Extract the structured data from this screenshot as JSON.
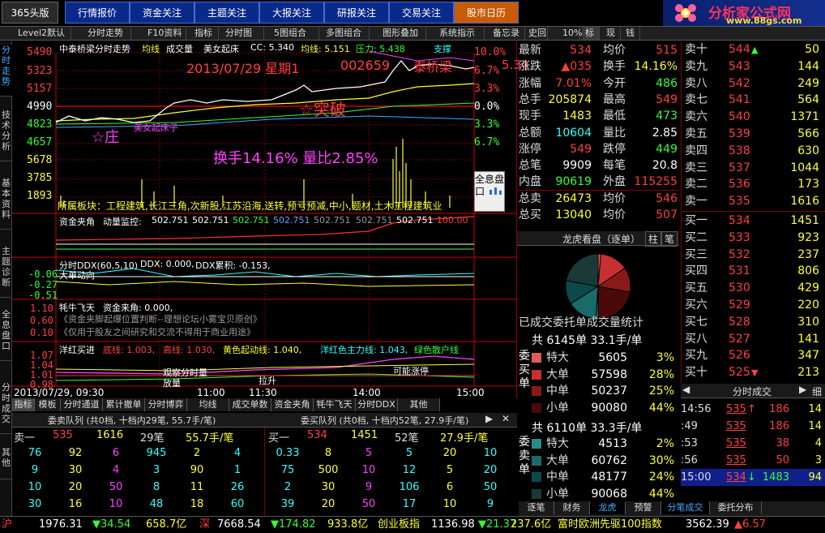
{
  "top_tabs": [
    "365头版",
    "行情报价",
    "资金关注",
    "主题关注",
    "大报关注",
    "研报关注",
    "交易关注",
    "股市日历"
  ],
  "logo": {
    "title": "分析家公式网",
    "url": "www.88gs.com"
  },
  "toolbar": [
    "Level2默认",
    "分时走势",
    "F10资料",
    "指标",
    "分时图",
    "5图组合",
    "多图组合",
    "图形叠加",
    "系统指示",
    "备忘录",
    "史回",
    "10%",
    "标",
    "现",
    "钱"
  ],
  "left_tabs": [
    "分时走势",
    "技术分析",
    "基本资料",
    "主题诊断",
    "全息盘口",
    "分时成交",
    "其他"
  ],
  "chart": {
    "header": "中泰桥梁分时走势",
    "header_avg": "均线",
    "header_vol": "成交量",
    "header_ind": "美女起床",
    "header_cc": "CC: 5.340",
    "header_jx": "均线: 5.151",
    "header_yl": "压力: 5.438",
    "header_zc": "支撑",
    "date_text": "2013/07/29 星期1",
    "code": "002659",
    "name_overlay": "泰桥梁",
    "right_price": "5.34",
    "tupo": "☆突破",
    "zhuang": "☆庄",
    "qichuang": "美女起床子",
    "turnover_text": "换手14.16% 量比2.85%",
    "prices": [
      "5490",
      "5323",
      "5157",
      "4990",
      "4823",
      "4657",
      "5678",
      "3785",
      "1893"
    ],
    "pcts": [
      "10.0%",
      "6.7%",
      "3.3%",
      "0.0%",
      "3.3%",
      "6.7%"
    ],
    "sector": "所属板块：工程建筑,长江三角,次新股,江苏沿海,送转,预亏预减,中小,题材,土木工程建筑业",
    "info_box": "全息盘口",
    "panel2_title": "资金夹角",
    "panel2_label": "动量监控:",
    "panel2_values": [
      "502.751",
      "502.751",
      "502.751",
      "502.751",
      "502.751",
      "502.751",
      "502.751",
      "100.00"
    ],
    "panel3_title": "分时DDX(60,5,10)",
    "panel3_ddx": "DDX: 0.000,",
    "panel3_ddxlj": "DDX累积: -0.153,",
    "panel3_sub": "大单动向",
    "panel3_axis": [
      "-0.06",
      "-0.27",
      "-0.51"
    ],
    "panel4_title": "牦牛飞天",
    "panel4_val": "资金来角: 0.000,",
    "panel4_line1": "《资金夹脚起爆位置判断--理想论坛小雾宝贝原创》",
    "panel4_line2": "《仅用于股友之间研究和交流不得用于商业用途》",
    "panel4_axis": [
      "1.10",
      "0.60",
      "0.10"
    ],
    "panel5_title": "洋红买进",
    "panel5_base": "底线: 1.003,",
    "panel5_high": "高线: 1.030,",
    "panel5_yellow": "黄色起动线: 1.040,",
    "panel5_ym": "洋红色主力线: 1.043,",
    "panel5_green": "绿色散户线",
    "panel5_axis": [
      "1.07",
      "1.04",
      "1.01",
      "0.98"
    ],
    "panel5_labels": [
      "观察分时量",
      "放量",
      "拉升",
      "可能涨停"
    ],
    "time_axis": [
      "2013/07/29, 09:30",
      "11:00",
      "11:30",
      "14:00",
      "15:00"
    ],
    "bottom_tabs": [
      "指标",
      "模板",
      "分时通道",
      "累计撤单",
      "分时博弈",
      "均线",
      "成交单数",
      "资金夹角",
      "牦牛飞天",
      "分时DDX",
      "其他"
    ]
  },
  "quotes": {
    "rows": [
      {
        "l": "最新",
        "v": "534",
        "l2": "均价",
        "v2": "515"
      },
      {
        "l": "涨跌",
        "v": "▲035",
        "l2": "换手",
        "v2": "14.16%"
      },
      {
        "l": "涨幅",
        "v": "7.01%",
        "l2": "今开",
        "v2": "486"
      },
      {
        "l": "总手",
        "v": "205874",
        "l2": "最高",
        "v2": "549"
      },
      {
        "l": "现手",
        "v": "1483",
        "l2": "最低",
        "v2": "473"
      },
      {
        "l": "总额",
        "v": "10604",
        "l2": "量比",
        "v2": "2.85"
      },
      {
        "l": "涨停",
        "v": "549",
        "l2": "跌停",
        "v2": "449"
      },
      {
        "l": "总笔",
        "v": "9909",
        "l2": "每笔",
        "v2": "20.8"
      },
      {
        "l": "内盘",
        "v": "90619",
        "l2": "外盘",
        "v2": "115255"
      },
      {
        "l": "总卖",
        "v": "26473",
        "l2": "均价",
        "v2": "546"
      },
      {
        "l": "总买",
        "v": "13040",
        "l2": "均价",
        "v2": "507"
      }
    ]
  },
  "book": {
    "asks": [
      {
        "l": "卖十",
        "p": "544",
        "a": "▲",
        "v": "50"
      },
      {
        "l": "卖九",
        "p": "543",
        "a": "",
        "v": "144"
      },
      {
        "l": "卖八",
        "p": "542",
        "a": "",
        "v": "249"
      },
      {
        "l": "卖七",
        "p": "541",
        "a": "",
        "v": "564"
      },
      {
        "l": "卖六",
        "p": "540",
        "a": "",
        "v": "1371"
      },
      {
        "l": "卖五",
        "p": "539",
        "a": "",
        "v": "566"
      },
      {
        "l": "卖四",
        "p": "538",
        "a": "",
        "v": "630"
      },
      {
        "l": "卖三",
        "p": "537",
        "a": "",
        "v": "1044"
      },
      {
        "l": "卖二",
        "p": "536",
        "a": "",
        "v": "173"
      },
      {
        "l": "卖一",
        "p": "535",
        "a": "",
        "v": "1616"
      }
    ],
    "bids": [
      {
        "l": "买一",
        "p": "534",
        "a": "",
        "v": "1451"
      },
      {
        "l": "买二",
        "p": "533",
        "a": "",
        "v": "923"
      },
      {
        "l": "买三",
        "p": "532",
        "a": "",
        "v": "237"
      },
      {
        "l": "买四",
        "p": "531",
        "a": "",
        "v": "806"
      },
      {
        "l": "买五",
        "p": "530",
        "a": "",
        "v": "429"
      },
      {
        "l": "买六",
        "p": "529",
        "a": "",
        "v": "220"
      },
      {
        "l": "买七",
        "p": "528",
        "a": "",
        "v": "310"
      },
      {
        "l": "买八",
        "p": "527",
        "a": "",
        "v": "141"
      },
      {
        "l": "买九",
        "p": "526",
        "a": "",
        "v": "347"
      },
      {
        "l": "买十",
        "p": "525",
        "a": "▼",
        "v": "213"
      }
    ]
  },
  "lhk": {
    "title": "龙虎看盘（逐单）",
    "btn1": "柱",
    "btn2": "笔",
    "pie_caption": "已成交委托单成交量统计",
    "buy_head": "共 6145单 33.1手/单",
    "buy_side": "委买单",
    "buy": [
      {
        "l": "特大",
        "v": "5605",
        "p": "3%"
      },
      {
        "l": "大单",
        "v": "57598",
        "p": "28%"
      },
      {
        "l": "中单",
        "v": "50237",
        "p": "25%"
      },
      {
        "l": "小单",
        "v": "90080",
        "p": "44%"
      }
    ],
    "sell_head": "共 6110单 33.3手/单",
    "sell_side": "委卖单",
    "sell": [
      {
        "l": "特大",
        "v": "4513",
        "p": "2%"
      },
      {
        "l": "大单",
        "v": "60762",
        "p": "30%"
      },
      {
        "l": "中单",
        "v": "48177",
        "p": "24%"
      },
      {
        "l": "小单",
        "v": "90068",
        "p": "44%"
      }
    ],
    "colors": [
      "#e05a5a",
      "#c83030",
      "#8a1a1a",
      "#4a0a0a",
      "#2a8a8a",
      "#1a6a6a",
      "#0a4a4a",
      "#1a3a3a"
    ]
  },
  "ticks": {
    "title": "分时成交",
    "fen": "细",
    "rows": [
      {
        "t": "14:56",
        "p": "535",
        "a": "↑",
        "v": "186",
        "n": "14"
      },
      {
        "t": ":49",
        "p": "535",
        "a": "",
        "v": "186",
        "n": "14"
      },
      {
        "t": ":53",
        "p": "535",
        "a": "",
        "v": "38",
        "n": "4"
      },
      {
        "t": ":56",
        "p": "535",
        "a": "",
        "v": "50",
        "n": "3"
      },
      {
        "t": "15:00",
        "p": "534",
        "a": "↓",
        "v": "1483",
        "n": "94"
      }
    ]
  },
  "bottom_book": {
    "sell_title": "委卖队列 (共0档, 十档内29笔, 55.7手/笔)",
    "buy_title": "委买队列 (共0档, 十档内52笔, 27.9手/笔)",
    "sell_head": [
      "卖一",
      "535",
      "1616",
      "29笔",
      "55.7手/笔"
    ],
    "buy_head": [
      "买一",
      "534",
      "1451",
      "52笔",
      "27.9手/笔"
    ],
    "sell_grid": [
      [
        "76",
        "92",
        "6",
        "945",
        "2",
        "4"
      ],
      [
        "9",
        "30",
        "4",
        "3",
        "90",
        "1"
      ],
      [
        "10",
        "20",
        "50",
        "8",
        "11",
        "26"
      ],
      [
        "30",
        "16",
        "10",
        "48",
        "18",
        "60"
      ]
    ],
    "buy_grid": [
      [
        "0.33",
        "8",
        "5",
        "5",
        "20",
        "10"
      ],
      [
        "75",
        "500",
        "10",
        "12",
        "5",
        "20"
      ],
      [
        "2",
        "30",
        "9",
        "106",
        "6",
        "50"
      ],
      [
        "39",
        "20",
        "50",
        "17",
        "10",
        "9"
      ]
    ]
  },
  "bottom_right_tabs": [
    "逐笔",
    "财务",
    "龙虎",
    "预警",
    "分笔成交",
    "委托分布"
  ],
  "status": {
    "sh": "沪",
    "sh_idx": "1976.31",
    "sh_chg": "▼34.54",
    "sh_amt": "658.7亿",
    "sz": "深",
    "sz_idx": "7668.54",
    "sz_chg": "▼174.82",
    "sz_amt": "933.8亿",
    "cy": "创业板指",
    "cy_idx": "1136.98",
    "cy_chg": "▼21.37",
    "cy_amt": "237.6亿",
    "ft": "富时欧洲先驱100指数",
    "ft_idx": "3562.39",
    "ft_chg": "▲6.57"
  }
}
